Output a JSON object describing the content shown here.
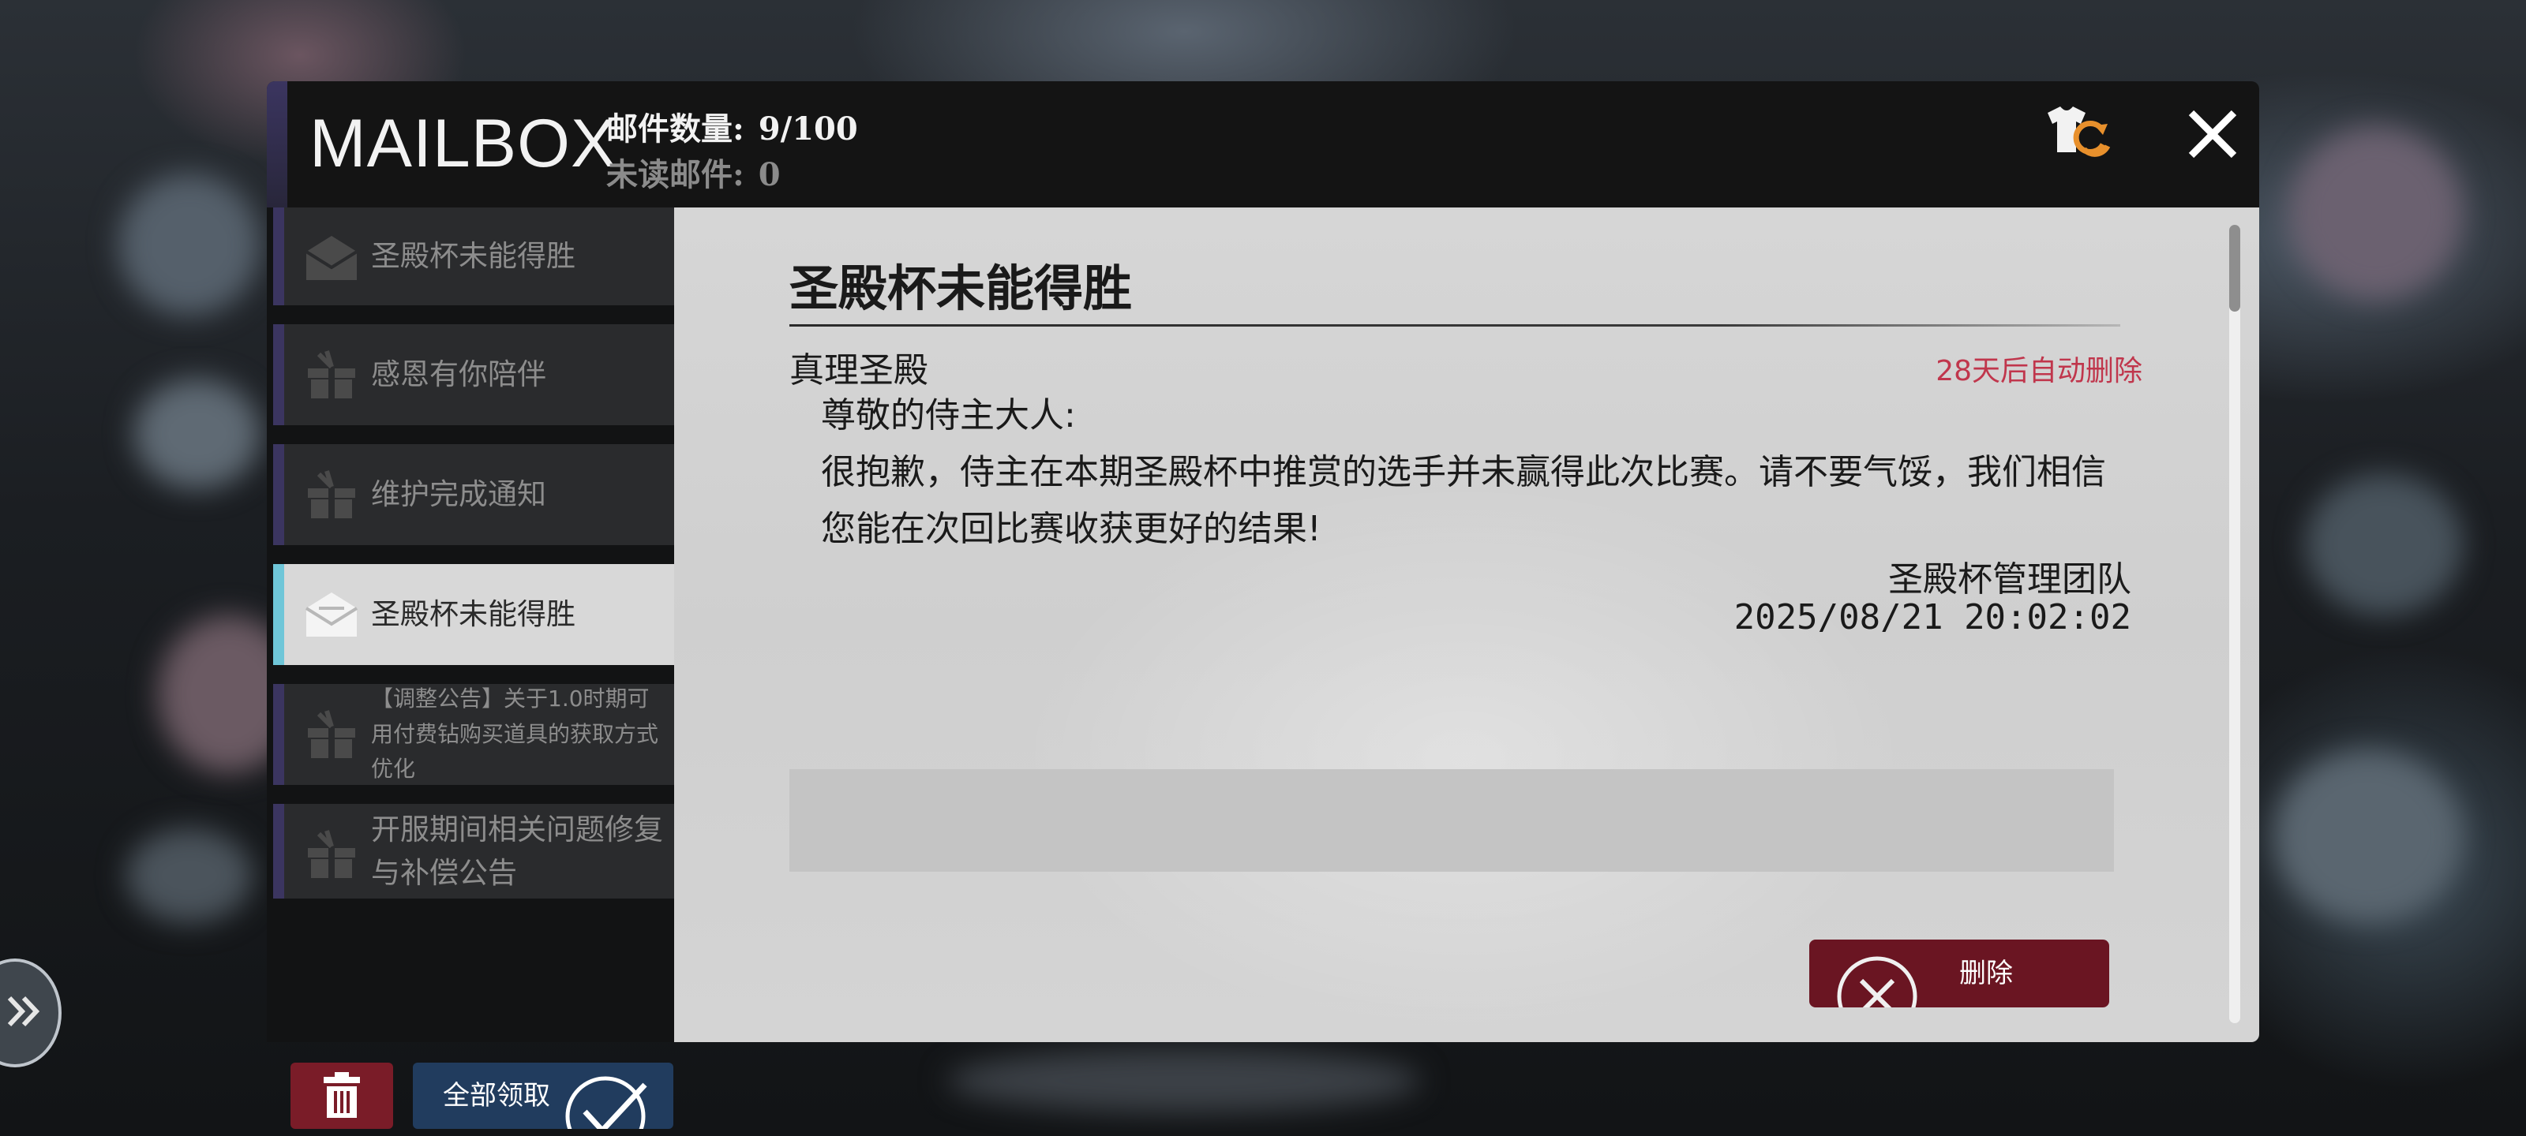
{
  "header": {
    "title": "MAILBOX",
    "mail_count_label": "邮件数量:",
    "mail_count_value": "9/100",
    "unread_label": "未读邮件:",
    "unread_value": "0"
  },
  "icons": {
    "wardrobe": "shirt-swap-icon",
    "close": "close-icon",
    "trash": "trash-icon",
    "claim_check": "check-icon",
    "delete_x": "x-circle-icon",
    "side_handle": "chevron-double-right-icon"
  },
  "sidebar": {
    "items": [
      {
        "label": "圣殿杯未能得胜",
        "icon": "opened-envelope-icon",
        "active": false
      },
      {
        "label": "感恩有你陪伴",
        "icon": "gift-box-icon",
        "active": false
      },
      {
        "label": "维护完成通知",
        "icon": "gift-box-icon",
        "active": false
      },
      {
        "label": "圣殿杯未能得胜",
        "icon": "opened-envelope-icon",
        "active": true
      },
      {
        "label": "【调整公告】关于1.0时期可用付费钻购买道具的获取方式优化",
        "icon": "gift-box-icon",
        "active": false
      },
      {
        "label": "开服期间相关问题修复与补偿公告",
        "icon": "gift-box-icon",
        "active": false
      }
    ],
    "claim_all_label": "全部领取"
  },
  "mail": {
    "title": "圣殿杯未能得胜",
    "sender": "真理圣殿",
    "expire": "28天后自动删除",
    "greeting": "尊敬的侍主大人:",
    "body": "很抱歉，侍主在本期圣殿杯中推赏的选手并未赢得此次比赛。请不要气馁，我们相信您能在次回比赛收获更好的结果!",
    "signature_team": "圣殿杯管理团队",
    "signature_date": "2025/08/21 20:02:02",
    "delete_label": "删除"
  },
  "colors": {
    "accent_purple": "#3b3560",
    "active_accent": "#6fc6d8",
    "expire_red": "#c0364c",
    "delete_red": "#6a1522",
    "claim_blue": "#213c5e"
  }
}
